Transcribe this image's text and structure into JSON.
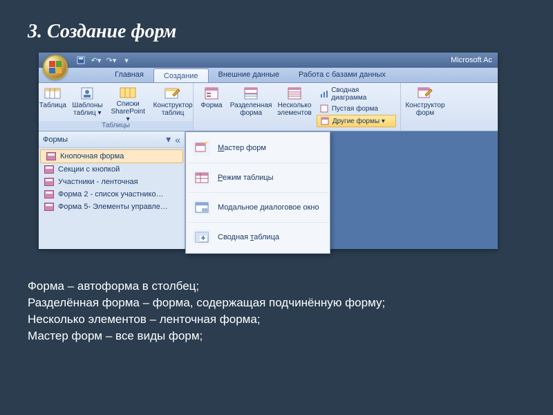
{
  "slide": {
    "title": "3. Создание форм",
    "notes": [
      "Форма – автоформа в столбец;",
      "Разделённая форма – форма, содержащая подчинённую форму;",
      "Несколько элементов – ленточная форма;",
      "Мастер форм – все виды форм;"
    ]
  },
  "titlebar": {
    "app_name": "Microsoft Ac"
  },
  "tabs": {
    "items": [
      "Главная",
      "Создание",
      "Внешние данные",
      "Работа с базами данных"
    ],
    "active_index": 1
  },
  "ribbon": {
    "groups": [
      {
        "label": "Таблицы",
        "buttons": [
          {
            "name": "table-button",
            "label": "Таблица"
          },
          {
            "name": "table-templates-button",
            "label": "Шаблоны\nтаблиц ▾"
          },
          {
            "name": "sharepoint-lists-button",
            "label": "Списки\nSharePoint ▾"
          },
          {
            "name": "table-designer-button",
            "label": "Конструктор\nтаблиц"
          }
        ]
      },
      {
        "label": "",
        "buttons": [
          {
            "name": "form-button",
            "label": "Форма"
          },
          {
            "name": "split-form-button",
            "label": "Разделенная\nформа"
          },
          {
            "name": "multiple-items-button",
            "label": "Несколько\nэлементов"
          }
        ],
        "minis": [
          {
            "name": "pivot-chart-button",
            "label": "Сводная диаграмма"
          },
          {
            "name": "blank-form-button",
            "label": "Пустая форма"
          },
          {
            "name": "more-forms-button",
            "label": "Другие формы ▾",
            "selected": true
          }
        ]
      },
      {
        "label": "",
        "buttons": [
          {
            "name": "form-designer-button",
            "label": "Конструктор\nформ"
          }
        ]
      }
    ]
  },
  "navpane": {
    "header": "Формы",
    "items": [
      "Кнопочная форма",
      "Секции с кнопкой",
      "Участники - ленточная",
      "Форма 2 - список участнико…",
      "Форма 5- Элементы управле…"
    ],
    "selected_index": 0
  },
  "dropdown": {
    "items": [
      {
        "name": "form-wizard-item",
        "label": "Мастер форм",
        "u": 0
      },
      {
        "name": "datasheet-item",
        "label": "Режим таблицы",
        "u": 0
      },
      {
        "name": "modal-dialog-item",
        "label": "Модальное диалоговое окно",
        "u": -1
      },
      {
        "name": "pivot-table-item",
        "label": "Сводная таблица",
        "u": 8
      }
    ]
  }
}
